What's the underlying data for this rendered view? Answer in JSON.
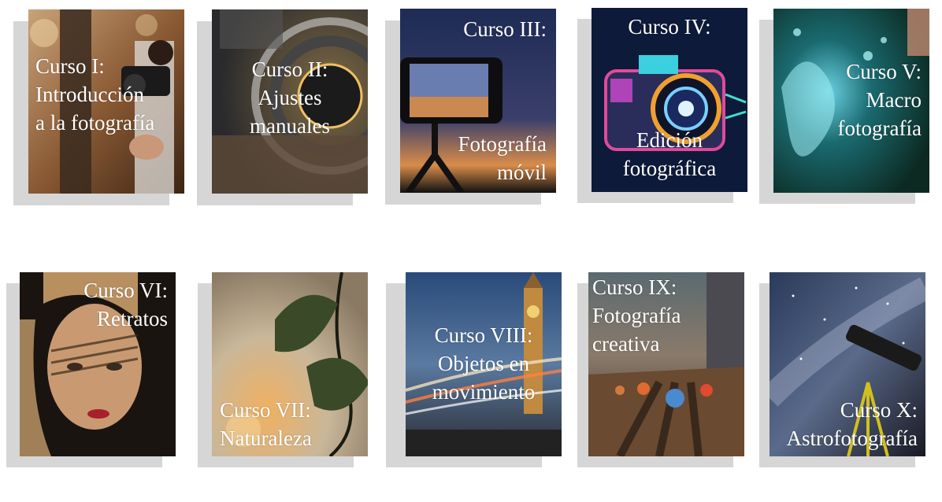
{
  "courses": [
    {
      "line1": "Curso I:",
      "line2": "Introducción",
      "line3": "a la fotografía"
    },
    {
      "line1": "Curso II:",
      "line2": "Ajustes",
      "line3": "manuales"
    },
    {
      "line1": "Curso III:",
      "line2": "Fotografía",
      "line3": "móvil"
    },
    {
      "line1": "Curso IV:",
      "line2": "Edición",
      "line3": "fotográfica"
    },
    {
      "line1": "Curso V:",
      "line2": "Macro",
      "line3": "fotografía"
    },
    {
      "line1": "Curso VI:",
      "line2": "Retratos"
    },
    {
      "line1": "Curso VII:",
      "line2": "Naturaleza"
    },
    {
      "line1": "Curso VIII:",
      "line2": "Objetos en",
      "line3": "movimiento"
    },
    {
      "line1": "Curso IX:",
      "line2": "Fotografía",
      "line3": "creativa"
    },
    {
      "line1": "Curso X:",
      "line2": "Astrofotografía"
    }
  ],
  "colors": {
    "shadow": "#d6d6d6",
    "text": "#ffffff"
  }
}
